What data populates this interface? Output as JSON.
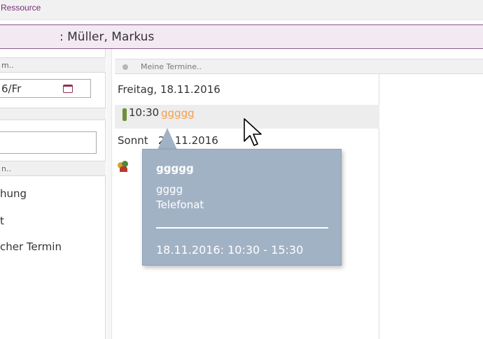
{
  "header": {
    "breadcrumb": "Ressource"
  },
  "resource": {
    "title": ": Müller, Markus"
  },
  "left_panel": {
    "header1": "m..",
    "date_value": "6/Fr",
    "header3": "n..",
    "items": [
      "hung",
      "t",
      "cher Termin"
    ]
  },
  "right_panel": {
    "header": "Meine Termine..",
    "days": [
      {
        "label": "Freitag, 18.11.2016"
      },
      {
        "label": "Sonnt   20.11.2016"
      }
    ],
    "appointment": {
      "time": "10:30",
      "title": "ggggg"
    }
  },
  "tooltip": {
    "title": "ggggg",
    "subtitle": "gggg",
    "type": "Telefonat",
    "time_range": "18.11.2016: 10:30 - 15:30"
  },
  "colors": {
    "accent_purple": "#7a2d7a",
    "resource_bar_bg": "#f3e9f3",
    "tooltip_bg": "#a2b2c5",
    "appointment_link": "#f1a04e"
  },
  "icons": [
    "calendar-icon",
    "phone-icon",
    "people-icon",
    "status-dot-icon",
    "mouse-pointer-icon"
  ]
}
